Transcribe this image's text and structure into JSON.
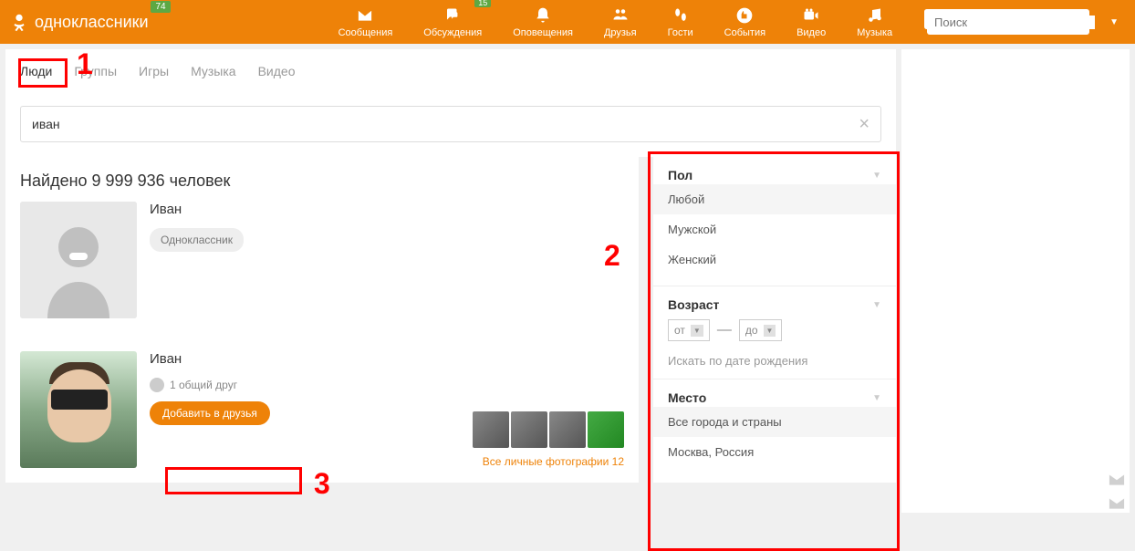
{
  "header": {
    "site_name": "одноклассники",
    "notification_badge": "74",
    "nav": [
      {
        "label": "Сообщения",
        "icon": "mail",
        "badge": null
      },
      {
        "label": "Обсуждения",
        "icon": "chat",
        "badge": "15"
      },
      {
        "label": "Оповещения",
        "icon": "bell",
        "badge": null
      },
      {
        "label": "Друзья",
        "icon": "friends",
        "badge": null
      },
      {
        "label": "Гости",
        "icon": "guests",
        "badge": null
      },
      {
        "label": "События",
        "icon": "events",
        "badge": null
      },
      {
        "label": "Видео",
        "icon": "video",
        "badge": null
      },
      {
        "label": "Музыка",
        "icon": "music",
        "badge": null
      }
    ],
    "search_placeholder": "Поиск"
  },
  "tabs": {
    "items": [
      "Люди",
      "Группы",
      "Игры",
      "Музыка",
      "Видео"
    ],
    "active_index": 0
  },
  "search": {
    "value": "иван"
  },
  "results": {
    "count_text": "Найдено 9 999 936 человек",
    "items": [
      {
        "name": "Иван",
        "tag": "Одноклассник",
        "has_avatar": false
      },
      {
        "name": "Иван",
        "mutual_text": "1 общий друг",
        "add_button": "Добавить в друзья",
        "all_photos_text": "Все личные фотографии 12",
        "photo_count": 4,
        "has_avatar": true
      }
    ]
  },
  "filters": {
    "gender": {
      "title": "Пол",
      "options": [
        "Любой",
        "Мужской",
        "Женский"
      ],
      "selected_index": 0
    },
    "age": {
      "title": "Возраст",
      "from_label": "от",
      "to_label": "до",
      "birth_link": "Искать по дате рождения"
    },
    "location": {
      "title": "Место",
      "options": [
        "Все города и страны",
        "Москва, Россия"
      ],
      "selected_index": 0
    }
  },
  "annotations": {
    "a1": "1",
    "a2": "2",
    "a3": "3"
  },
  "colors": {
    "brand": "#ee8208",
    "badge": "#5da843",
    "highlight": "#ff0000"
  }
}
